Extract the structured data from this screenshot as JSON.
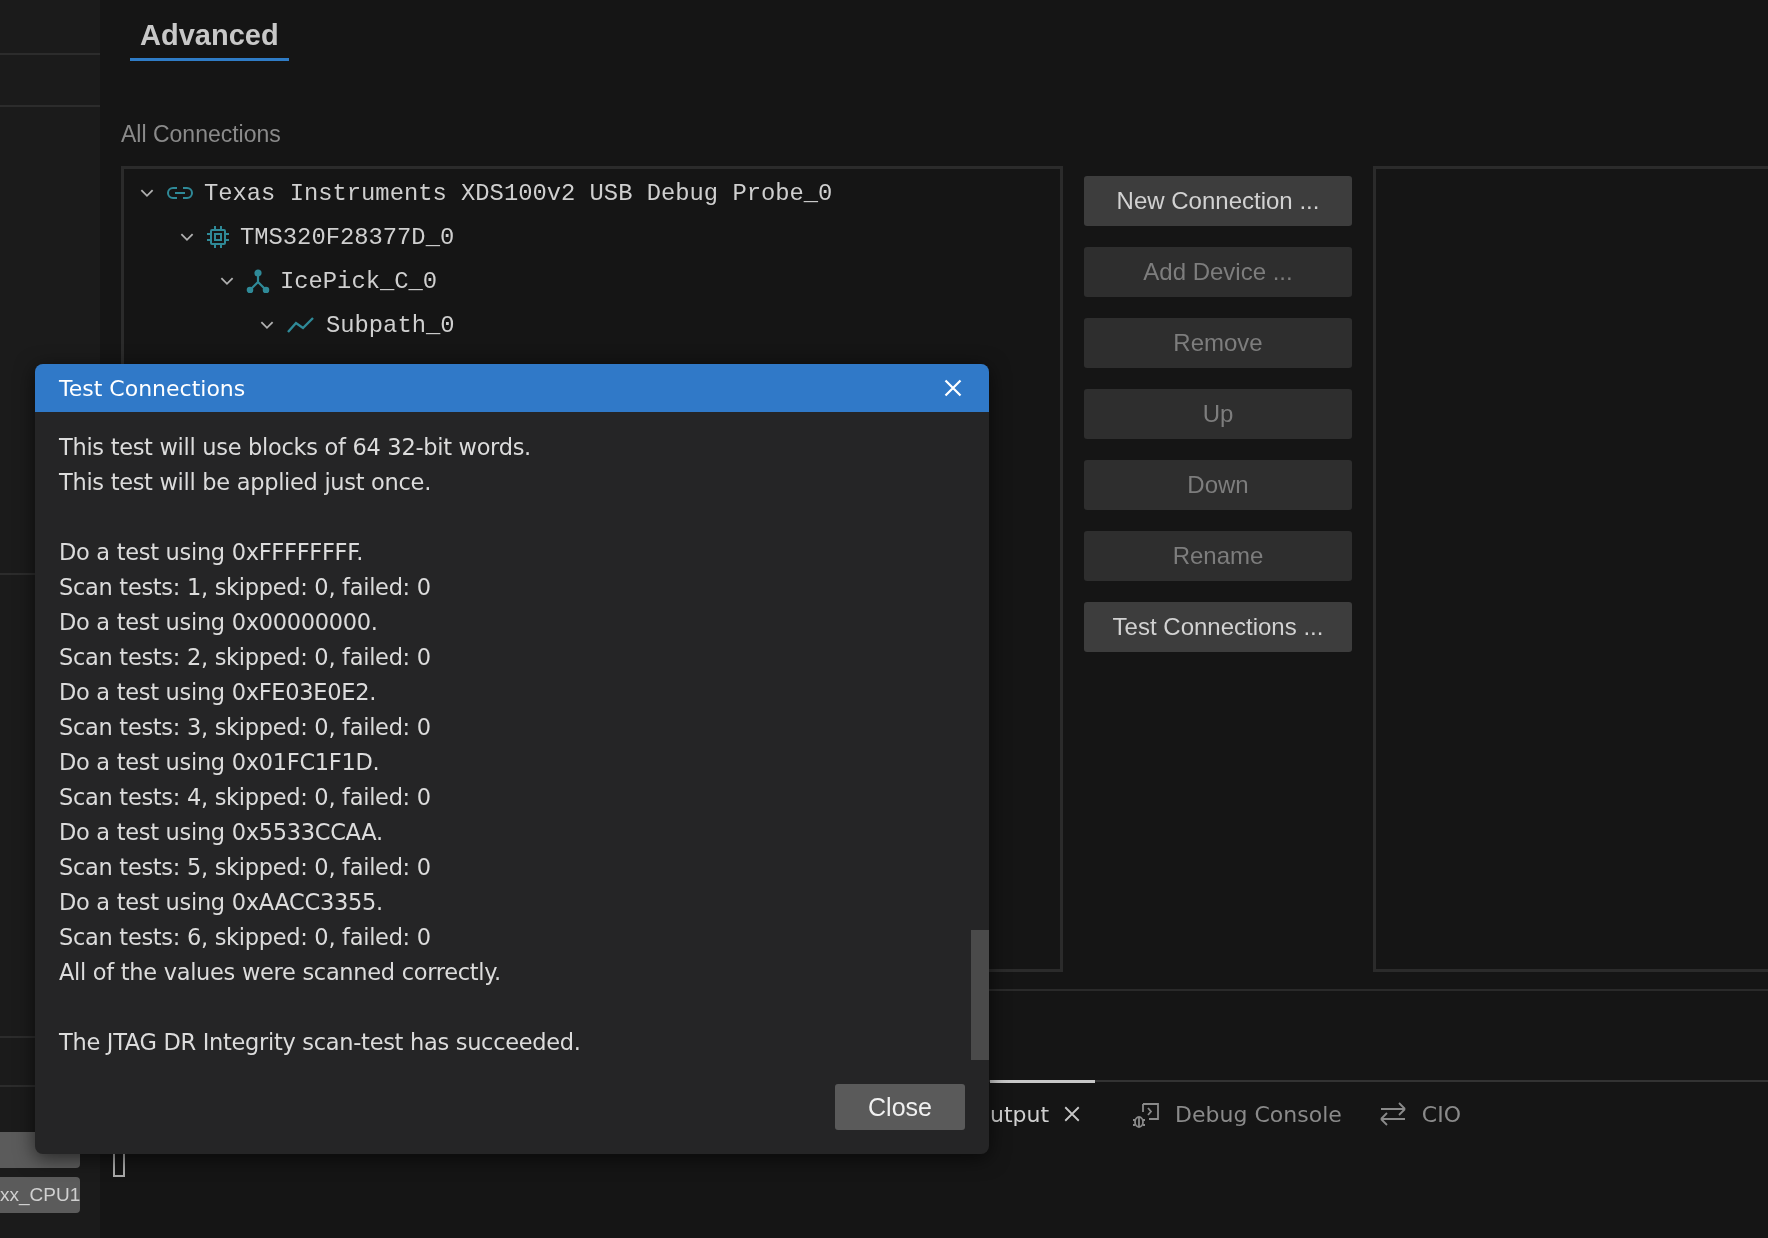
{
  "header": {
    "tabs": [
      {
        "label": "Advanced",
        "selected": true
      }
    ]
  },
  "connections": {
    "title": "All Connections",
    "tree": [
      {
        "label": "Texas Instruments XDS100v2 USB Debug Probe_0",
        "kind": "link",
        "expanded": true,
        "children": [
          {
            "label": "TMS320F28377D_0",
            "kind": "chip",
            "expanded": true,
            "children": [
              {
                "label": "IcePick_C_0",
                "kind": "router",
                "expanded": true,
                "children": [
                  {
                    "label": "Subpath_0",
                    "kind": "path",
                    "expanded": true
                  }
                ]
              }
            ]
          }
        ]
      }
    ]
  },
  "buttons": [
    {
      "label": "New Connection ...",
      "disabled": false
    },
    {
      "label": "Add Device ...",
      "disabled": true
    },
    {
      "label": "Remove",
      "disabled": true
    },
    {
      "label": "Up",
      "disabled": true
    },
    {
      "label": "Down",
      "disabled": true
    },
    {
      "label": "Rename",
      "disabled": true
    },
    {
      "label": "Test Connections ...",
      "disabled": false
    }
  ],
  "sidebar": {
    "items": [
      {
        "label": "xx_CPU1"
      }
    ]
  },
  "panel": {
    "tabs": [
      {
        "label": "utput",
        "kind": "output",
        "selected": true,
        "closable": true
      },
      {
        "label": "Debug Console",
        "kind": "debug",
        "selected": false,
        "closable": false
      },
      {
        "label": "CIO",
        "kind": "cio",
        "selected": false,
        "closable": false
      }
    ]
  },
  "dialog": {
    "title": "Test Connections",
    "paragraphs": [
      {
        "lines": [
          "This test will use blocks of 64 32-bit words.",
          "This test will be applied just once."
        ]
      },
      {
        "lines": [
          "Do a test using 0xFFFFFFFF.",
          "Scan tests: 1, skipped: 0, failed: 0",
          "Do a test using 0x00000000.",
          "Scan tests: 2, skipped: 0, failed: 0",
          "Do a test using 0xFE03E0E2.",
          "Scan tests: 3, skipped: 0, failed: 0",
          "Do a test using 0x01FC1F1D.",
          "Scan tests: 4, skipped: 0, failed: 0",
          "Do a test using 0x5533CCAA.",
          "Scan tests: 5, skipped: 0, failed: 0",
          "Do a test using 0xAACC3355.",
          "Scan tests: 6, skipped: 0, failed: 0",
          "All of the values were scanned correctly."
        ]
      },
      {
        "lines": [
          "The JTAG DR Integrity scan-test has succeeded."
        ]
      }
    ],
    "close_button": "Close"
  }
}
